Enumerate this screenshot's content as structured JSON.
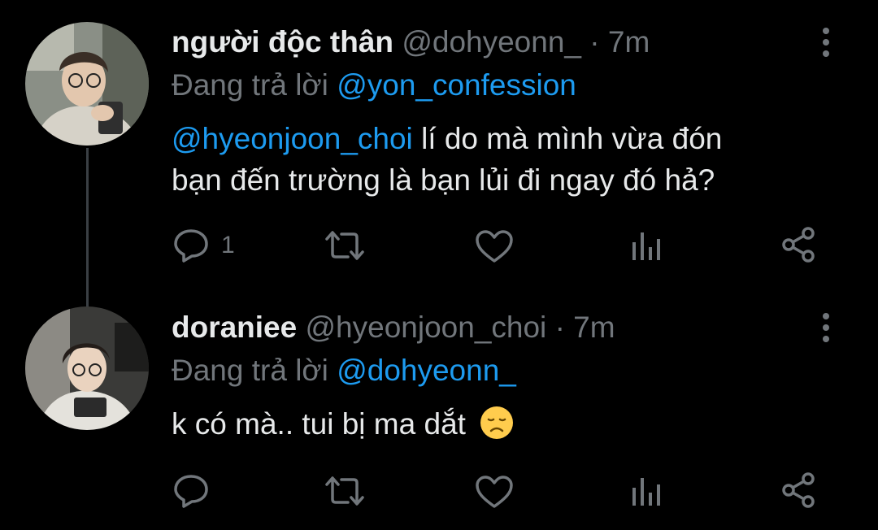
{
  "thread_line_color": "#3a3f44",
  "link_color": "#1d9bf0",
  "muted_color": "#71767b",
  "tweets": [
    {
      "display_name": "người độc thân",
      "handle": "@dohyeonn_",
      "separator": "·",
      "time": "7m",
      "replying_label": "Đang trả lời",
      "replying_to": "@yon_confession",
      "mention": "@hyeonjoon_choi",
      "text_line1": "lí do mà mình vừa đón",
      "text_line2": "bạn đến trường là bạn lủi đi ngay đó hả?",
      "reply_count": "1",
      "icons": [
        "reply-icon",
        "retweet-icon",
        "like-icon",
        "analytics-icon",
        "share-icon",
        "more-icon"
      ]
    },
    {
      "display_name": "doraniee",
      "handle": "@hyeonjoon_choi",
      "separator": "·",
      "time": "7m",
      "replying_label": "Đang trả lời",
      "replying_to": "@dohyeonn_",
      "text": "k có mà.. tui bị ma dắt",
      "emoji": "disappointed-face-emoji",
      "icons": [
        "reply-icon",
        "retweet-icon",
        "like-icon",
        "analytics-icon",
        "share-icon",
        "more-icon"
      ]
    }
  ]
}
